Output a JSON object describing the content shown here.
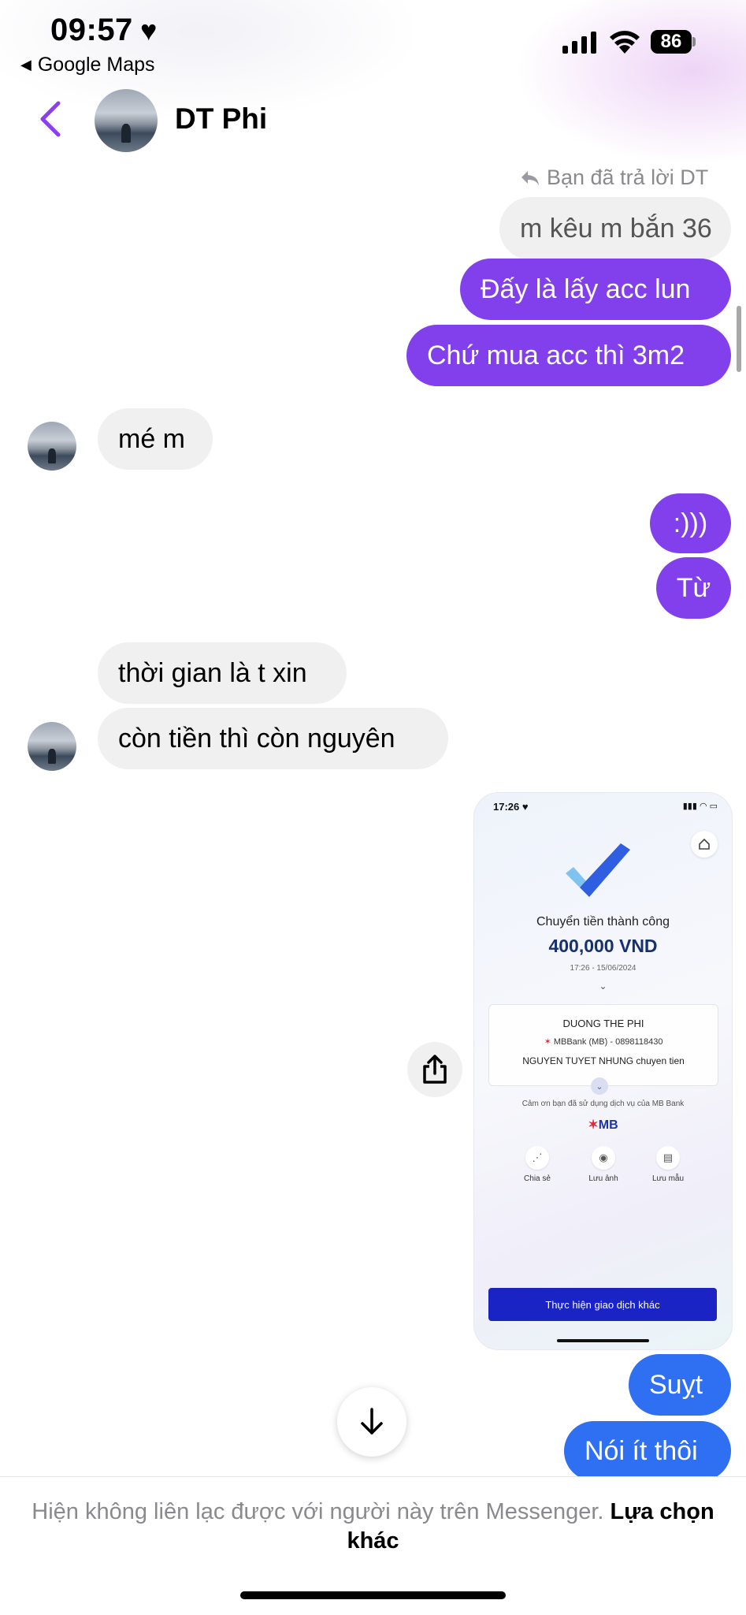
{
  "status_bar": {
    "time": "09:57",
    "heart": "♥",
    "back_app": "Google Maps",
    "battery": "86"
  },
  "header": {
    "contact_name": "DT Phi"
  },
  "reply_note": "Bạn đã trả lời DT",
  "messages": {
    "quoted": "m kêu m bắn 36",
    "m1": "Đấy là lấy acc lun",
    "m2": "Chứ mua acc thì 3m2",
    "m3": "mé m",
    "m4": ":)))",
    "m5": "Từ",
    "m6": "thời gian là t xin",
    "m7": "còn tiền thì còn nguyên",
    "m8": "Suỵt",
    "m9": "Nói ít thôi"
  },
  "receipt": {
    "time": "17:26",
    "title": "Chuyển tiền thành công",
    "amount": "400,000 VND",
    "datetime": "17:26 - 15/06/2024",
    "recipient": "DUONG THE PHI",
    "bank": "MBBank (MB) - 0898118430",
    "memo": "NGUYEN TUYET NHUNG chuyen tien",
    "thanks": "Cảm ơn bạn đã sử dụng dịch vụ của MB Bank",
    "logo": "MB",
    "actions": [
      "Chia sẻ",
      "Lưu ảnh",
      "Lưu mẫu"
    ],
    "button": "Thực hiện giao dịch khác"
  },
  "footer": {
    "notice": "Hiện không liên lạc được với người này trên Messenger.",
    "link": "Lựa chọn khác"
  },
  "colors": {
    "outgoing_purple": "#8140ec",
    "outgoing_blue": "#2f6ff2",
    "incoming": "#f0f0f0",
    "accent": "#8a3ff0"
  }
}
